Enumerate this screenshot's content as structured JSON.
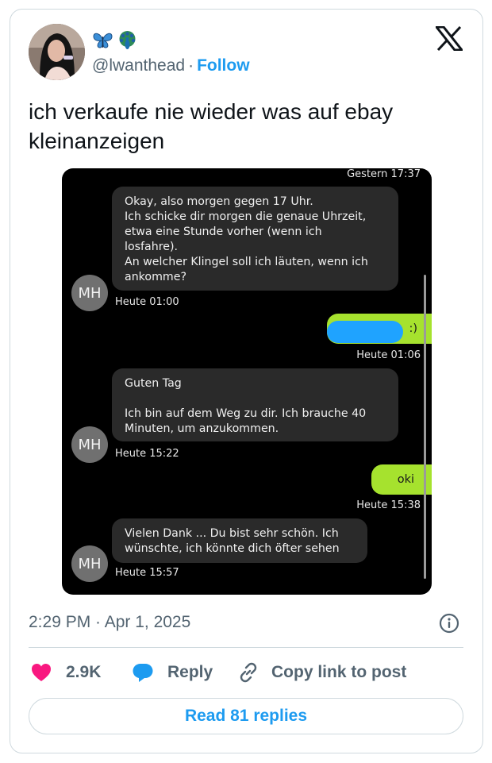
{
  "header": {
    "handle": "@lwanthead",
    "separator": "·",
    "follow_label": "Follow",
    "emojis": [
      "butterfly-emoji",
      "peacock-emoji"
    ]
  },
  "tweet": {
    "text": "ich verkaufe nie wieder was auf ebay kleinanzeigen"
  },
  "chat": {
    "top_timestamp": "Gestern 17:37",
    "messages": [
      {
        "side": "in",
        "text": "Okay, also morgen gegen 17 Uhr.\nIch schicke dir morgen die genaue Uhrzeit,\netwa eine Stunde vorher (wenn ich\nlosfahre).\nAn welcher Klingel soll ich läuten, wenn ich\nankomme?",
        "avatar": "MH",
        "time": "Heute 01:00"
      },
      {
        "side": "out",
        "text": ":)",
        "time": "Heute 01:06"
      },
      {
        "side": "in",
        "text": "Guten Tag\n\nIch bin auf dem Weg zu dir. Ich brauche 40\nMinuten, um anzukommen.",
        "avatar": "MH",
        "time": "Heute 15:22"
      },
      {
        "side": "out",
        "text": "oki",
        "time": "Heute 15:38"
      },
      {
        "side": "in",
        "text": "Vielen Dank ... Du bist sehr schön. Ich\nwünschte, ich könnte dich öfter sehen",
        "avatar": "MH",
        "time": "Heute 15:57"
      }
    ]
  },
  "meta": {
    "timestamp": "2:29 PM · Apr 1, 2025"
  },
  "actions": {
    "likes": "2.9K",
    "reply_label": "Reply",
    "copy_label": "Copy link to post"
  },
  "read_replies_label": "Read 81 replies",
  "colors": {
    "accent": "#1d9bf0",
    "like": "#f91880",
    "chat_out_bubble": "#a6e22e",
    "chat_in_bubble": "#2a2a2a"
  }
}
